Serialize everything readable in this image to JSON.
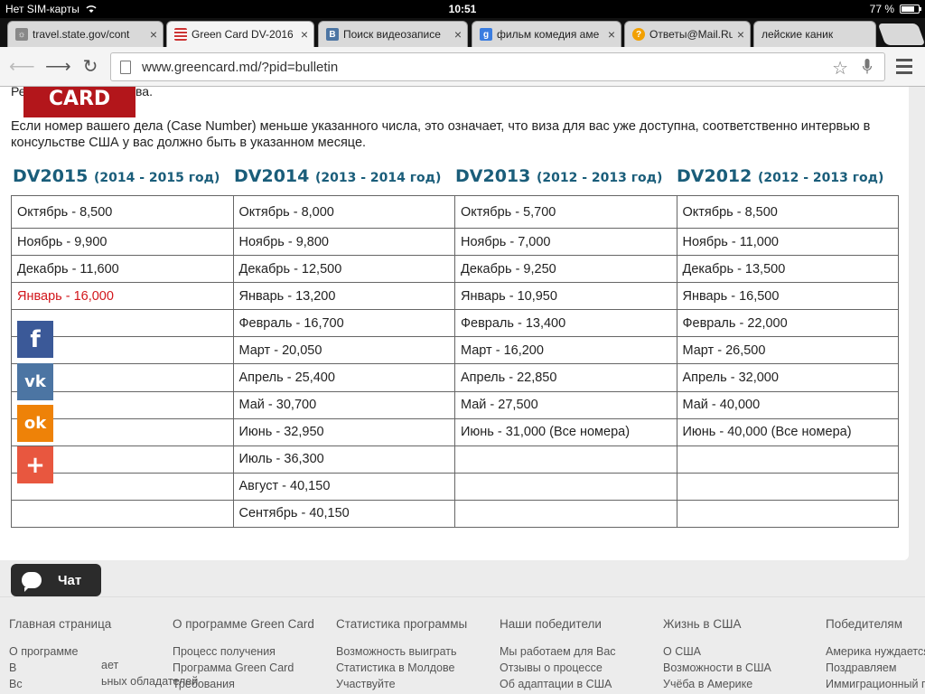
{
  "status": {
    "carrier": "Нет SIM-карты",
    "time": "10:51",
    "battery": "77 %",
    "battery_level": 0.77
  },
  "tabs": [
    {
      "title": "travel.state.gov/cont",
      "active": false
    },
    {
      "title": "Green Card DV-2016",
      "active": true
    },
    {
      "title": "Поиск видеозаписе",
      "active": false
    },
    {
      "title": "фильм комедия аме",
      "active": false
    },
    {
      "title": "Ответы@Mail.Ru: Ка",
      "active": false
    },
    {
      "title": "лейские каник",
      "active": false
    }
  ],
  "toolbar": {
    "url": "www.greencard.md/?pid=bulletin"
  },
  "page": {
    "logo_text": "CARD",
    "peek_left": "Ре",
    "peek_right": "ва.",
    "info_text": "Если номер вашего дела (Case Number) меньше указанного числа, это означает, что виза для вас уже доступна, соответственно интервью в консульстве США у вас должно быть в указанном месяце.",
    "columns": [
      {
        "name": "DV2015",
        "years": "(2014 - 2015 год)"
      },
      {
        "name": "DV2014",
        "years": "(2013 - 2014 год)"
      },
      {
        "name": "DV2013",
        "years": "(2012 - 2013 год)"
      },
      {
        "name": "DV2012",
        "years": "(2012 - 2013 год)"
      }
    ],
    "rows": [
      [
        "Октябрь - 8,500",
        "Октябрь - 8,000",
        "Октябрь - 5,700",
        "Октябрь - 8,500"
      ],
      [
        "Ноябрь - 9,900",
        "Ноябрь - 9,800",
        "Ноябрь - 7,000",
        "Ноябрь - 11,000"
      ],
      [
        "Декабрь - 11,600",
        "Декабрь - 12,500",
        "Декабрь - 9,250",
        "Декабрь - 13,500"
      ],
      [
        "Январь - 16,000",
        "Январь - 13,200",
        "Январь - 10,950",
        "Январь - 16,500"
      ],
      [
        "",
        "Февраль - 16,700",
        "Февраль - 13,400",
        "Февраль - 22,000"
      ],
      [
        "",
        "Март - 20,050",
        "Март - 16,200",
        "Март - 26,500"
      ],
      [
        "",
        "Апрель - 25,400",
        "Апрель - 22,850",
        "Апрель - 32,000"
      ],
      [
        "",
        "Май - 30,700",
        "Май - 27,500",
        "Май - 40,000"
      ],
      [
        "",
        "Июнь - 32,950",
        "Июнь - 31,000 (Все номера)",
        "Июнь - 40,000 (Все номера)"
      ],
      [
        "",
        "Июль - 36,300",
        "",
        ""
      ],
      [
        "",
        "Август - 40,150",
        "",
        ""
      ],
      [
        "",
        "Сентябрь - 40,150",
        "",
        ""
      ]
    ],
    "highlight_color": "#d2161b"
  },
  "social": [
    {
      "name": "facebook",
      "glyph": "f",
      "color": "#3b5998"
    },
    {
      "name": "vkontakte",
      "glyph": "vk",
      "color": "#4c75a3"
    },
    {
      "name": "odnoklassniki",
      "glyph": "ok",
      "color": "#ee8208"
    },
    {
      "name": "share-more",
      "glyph": "+",
      "color": "#e8573f"
    }
  ],
  "footer": {
    "columns": [
      {
        "heading": "Главная страница",
        "links": [
          "О программе",
          "В",
          "Вс"
        ]
      },
      {
        "heading": "О программе Green Card",
        "links": [
          "Процесс получения",
          "Программа Green Card",
          "Требования"
        ]
      },
      {
        "heading": "Статистика программы",
        "links": [
          "Возможность выиграть",
          "Статистика в Молдове",
          "Участвуйте"
        ]
      },
      {
        "heading": "Наши победители",
        "links": [
          "Мы работаем для Вас",
          "Отзывы о процессе",
          "Об адаптации в США"
        ]
      },
      {
        "heading": "Жизнь в США",
        "links": [
          "О США",
          "Возможности в США",
          "Учёба в Америке"
        ]
      },
      {
        "heading": "Победителям",
        "links": [
          "Америка нуждается",
          "Поздравляем",
          "Иммиграционный п"
        ]
      }
    ],
    "peek_under_chat": [
      "ает",
      "ьных обладателей"
    ]
  },
  "chat": {
    "label": "Чат"
  }
}
